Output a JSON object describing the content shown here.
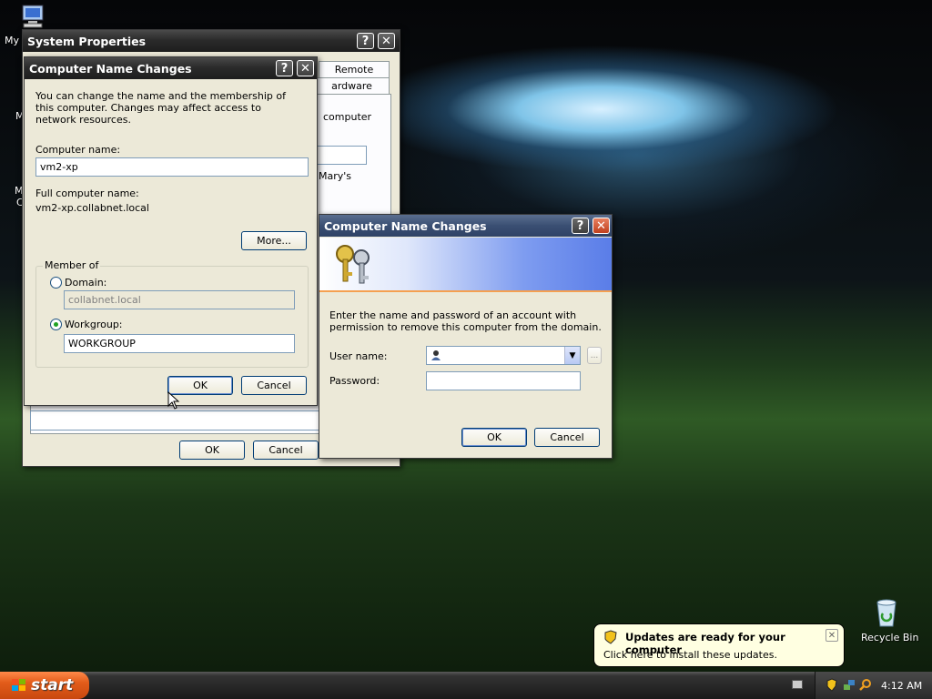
{
  "desktop": {
    "icons": [
      {
        "label": "My",
        "name": "my-computer"
      },
      {
        "label": "Recycle Bin",
        "name": "recycle-bin"
      }
    ],
    "partial_labels": [
      "M",
      "M",
      "C"
    ]
  },
  "system_properties": {
    "title": "System Properties",
    "tabs": [
      "Remote",
      "ardware"
    ],
    "text_fragments": [
      "computer",
      "Mary's"
    ],
    "ok_label": "OK",
    "cancel_label": "Cancel"
  },
  "name_changes": {
    "title": "Computer Name Changes",
    "intro": "You can change the name and the membership of this computer. Changes may affect access to network resources.",
    "computer_name_label": "Computer name:",
    "computer_name_value": "vm2-xp",
    "full_name_label": "Full computer name:",
    "full_name_value": "vm2-xp.collabnet.local",
    "more_label": "More...",
    "member_of_label": "Member of",
    "domain_label": "Domain:",
    "domain_value": "collabnet.local",
    "workgroup_label": "Workgroup:",
    "workgroup_value": "WORKGROUP",
    "ok_label": "OK",
    "cancel_label": "Cancel"
  },
  "credentials": {
    "title": "Computer Name Changes",
    "message": "Enter the name and password of an account with permission to remove this computer from the domain.",
    "username_label": "User name:",
    "username_value": "",
    "browse_label": "...",
    "password_label": "Password:",
    "password_value": "",
    "ok_label": "OK",
    "cancel_label": "Cancel"
  },
  "taskbar": {
    "start_label": "start",
    "clock": "4:12 AM"
  },
  "balloon": {
    "title": "Updates are ready for your computer",
    "text": "Click here to install these updates."
  },
  "colors": {
    "dialog_bg": "#ece9d8",
    "start_button": "#e25c1a",
    "balloon_bg": "#ffffe1"
  }
}
